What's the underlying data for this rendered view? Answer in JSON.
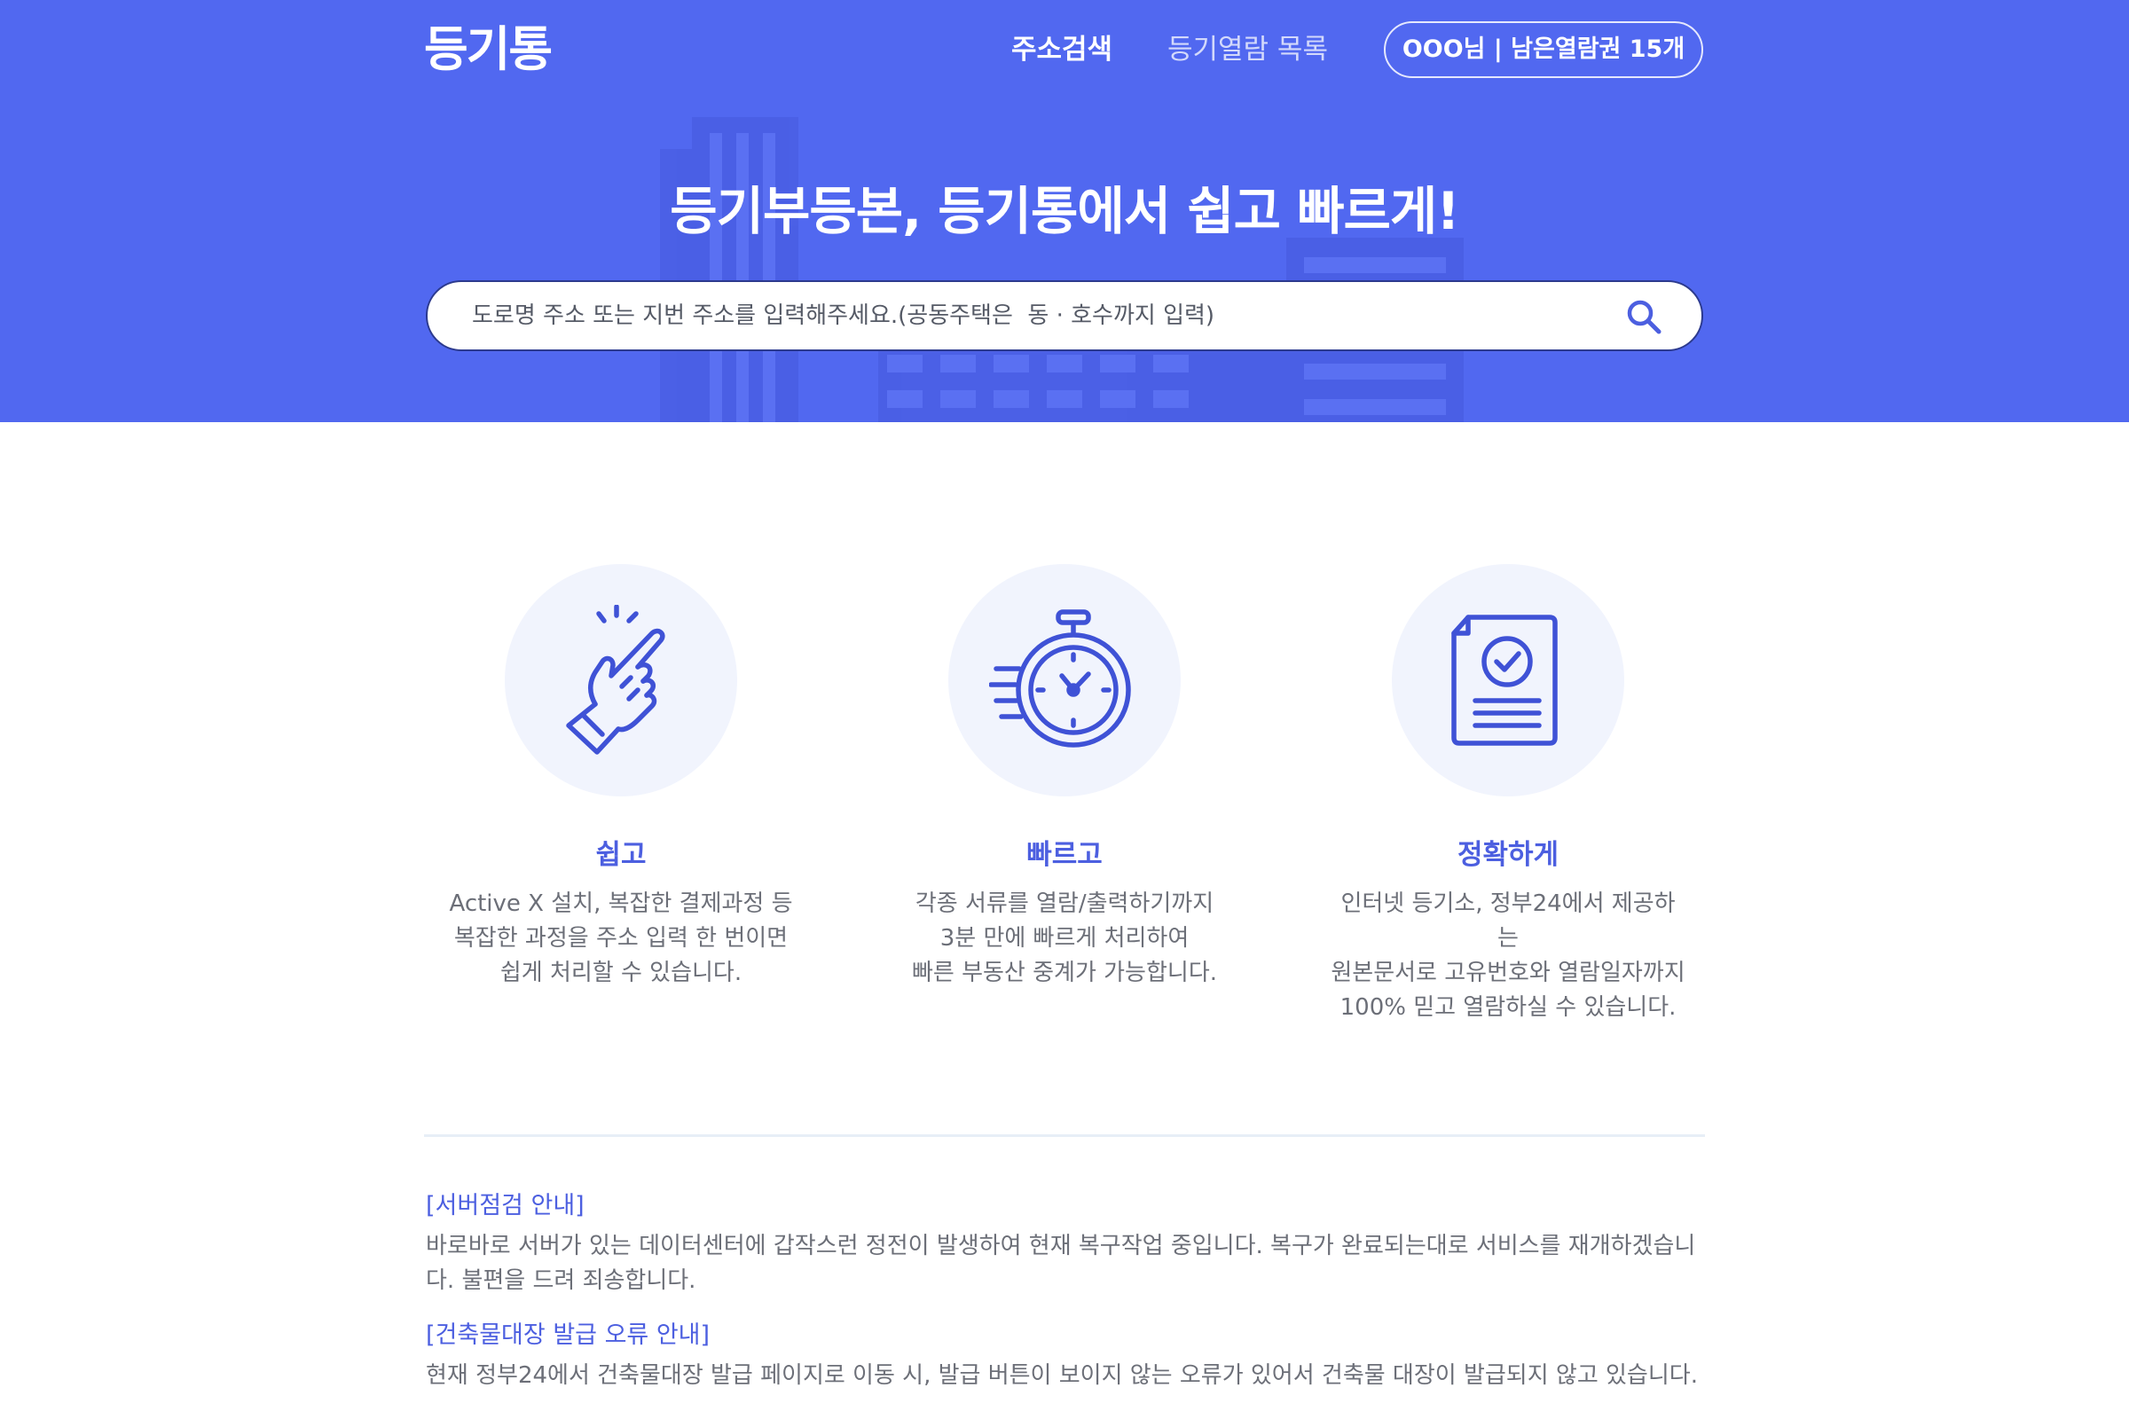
{
  "header": {
    "logo": "등기통",
    "nav": {
      "search": "주소검색",
      "list": "등기열람 목록"
    },
    "user_status": "OOO님 | 남은열람권 15개"
  },
  "hero": {
    "title": "등기부등본, 등기통에서 쉽고 빠르게!",
    "search_placeholder": "도로명 주소 또는 지번 주소를 입력해주세요.(공동주택은  동 · 호수까지 입력)"
  },
  "features": [
    {
      "icon": "pointing-hand-icon",
      "title": "쉽고",
      "lines": [
        "Active X 설치, 복잡한 결제과정 등",
        "복잡한 과정을 주소 입력 한 번이면",
        "쉽게 처리할 수 있습니다."
      ]
    },
    {
      "icon": "stopwatch-icon",
      "title": "빠르고",
      "lines": [
        "각종 서류를 열람/출력하기까지",
        "3분 만에 빠르게 처리하여",
        "빠른 부동산 중계가 가능합니다."
      ]
    },
    {
      "icon": "verified-document-icon",
      "title": "정확하게",
      "lines": [
        "인터넷 등기소, 정부24에서 제공하는",
        "원본문서로 고유번호와 열람일자까지",
        "100% 믿고 열람하실 수 있습니다."
      ]
    }
  ],
  "notices": [
    {
      "title": "[서버점검 안내]",
      "body": "바로바로 서버가 있는 데이터센터에 갑작스런 정전이 발생하여 현재 복구작업 중입니다. 복구가 완료되는대로 서비스를 재개하겠습니다. 불편을 드려 죄송합니다."
    },
    {
      "title": "[건축물대장 발급 오류 안내]",
      "body": "현재 정부24에서 건축물대장 발급 페이지로 이동 시, 발급 버튼이 보이지 않는 오류가 있어서 건축물 대장이 발급되지 않고 있습니다."
    }
  ],
  "colors": {
    "brand": "#5168f0",
    "accent_text": "#4c5fe0",
    "icon_stroke": "#3f52d6",
    "icon_bg": "#f1f4fd",
    "body_text": "#6c6f78"
  }
}
